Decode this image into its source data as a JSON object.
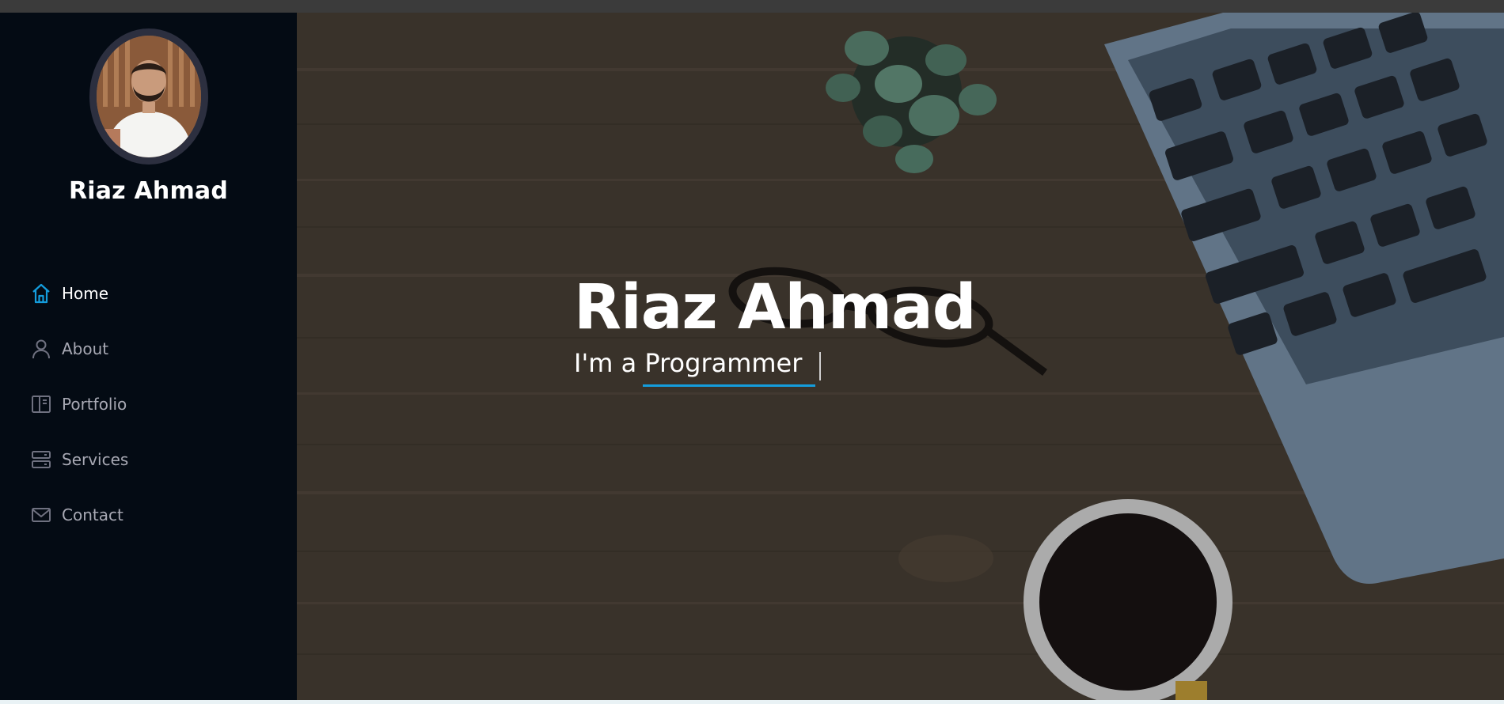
{
  "profile": {
    "name": "Riaz Ahmad"
  },
  "nav": {
    "items": [
      {
        "label": "Home",
        "icon": "home-icon",
        "active": true
      },
      {
        "label": "About",
        "icon": "person-icon",
        "active": false
      },
      {
        "label": "Portfolio",
        "icon": "book-icon",
        "active": false
      },
      {
        "label": "Services",
        "icon": "server-icon",
        "active": false
      },
      {
        "label": "Contact",
        "icon": "envelope-icon",
        "active": false
      }
    ]
  },
  "hero": {
    "title": "Riaz Ahmad",
    "subtitle_prefix": "I'm a",
    "typed_word": "Programmer"
  },
  "colors": {
    "accent": "#149ddd",
    "sidebar": "#040b14",
    "text_muted": "#a8a9b4"
  }
}
